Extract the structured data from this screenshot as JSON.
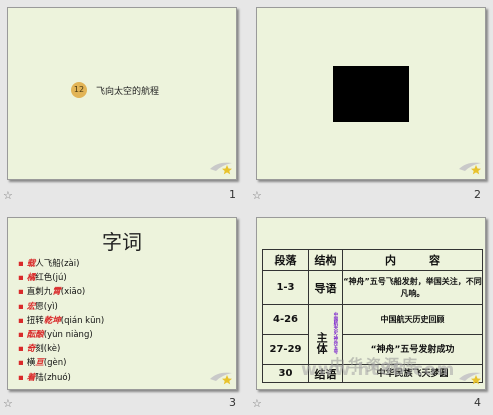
{
  "slides": [
    {
      "number": "1",
      "lesson_no": "12",
      "title": "飞向太空的航程"
    },
    {
      "number": "2"
    },
    {
      "number": "3",
      "heading": "字词",
      "vocab": [
        {
          "bullet": "▪",
          "parts": [
            {
              "t": "载",
              "r": true
            },
            {
              "t": "人飞船(zài)"
            }
          ]
        },
        {
          "bullet": "▪",
          "parts": [
            {
              "t": "橘",
              "r": true
            },
            {
              "t": "红色(jú)"
            }
          ]
        },
        {
          "bullet": "▪",
          "parts": [
            {
              "t": "直刺九"
            },
            {
              "t": "霄",
              "r": true
            },
            {
              "t": "(xiāo)"
            }
          ]
        },
        {
          "bullet": "▪",
          "parts": [
            {
              "t": "宏",
              "r": true
            },
            {
              "t": "愿(yì)"
            }
          ]
        },
        {
          "bullet": "▪",
          "parts": [
            {
              "t": "扭转"
            },
            {
              "t": "乾坤",
              "r": true
            },
            {
              "t": "(qián kūn)"
            }
          ]
        },
        {
          "bullet": "▪",
          "parts": [
            {
              "t": "酝酿",
              "r": true
            },
            {
              "t": "(yùn niàng)"
            }
          ]
        },
        {
          "bullet": "▪",
          "parts": [
            {
              "t": "奇",
              "r": true
            },
            {
              "t": "刻(kè)"
            }
          ]
        },
        {
          "bullet": "▪",
          "parts": [
            {
              "t": "横"
            },
            {
              "t": "亘",
              "r": true
            },
            {
              "t": "(gèn)"
            }
          ]
        },
        {
          "bullet": "▪",
          "parts": [
            {
              "t": "着",
              "r": true
            },
            {
              "t": "陆(zhuó)"
            }
          ]
        }
      ]
    },
    {
      "number": "4",
      "table": {
        "headers": [
          "段落",
          "结构",
          "内　　　容"
        ],
        "rows": [
          {
            "para": "1-3",
            "struct": "导语",
            "content": "“神舟”五号飞船发射，举国关注，不同凡响。"
          },
          {
            "para": "4-26",
            "struct": "主体",
            "content": "中国航天历史回顾"
          },
          {
            "para": "27-29",
            "struct": "",
            "content": "“神舟”五号发射成功"
          },
          {
            "para": "30",
            "struct": "结语",
            "content": "中华民族飞天梦圆"
          }
        ],
        "side_note": "中国航天史·神舟五号"
      }
    }
  ],
  "watermark": {
    "cn": "中华资源库",
    "url": "www.ht88.com"
  },
  "icons": {
    "star": "star-icon",
    "deco": "swoosh-star-icon"
  }
}
